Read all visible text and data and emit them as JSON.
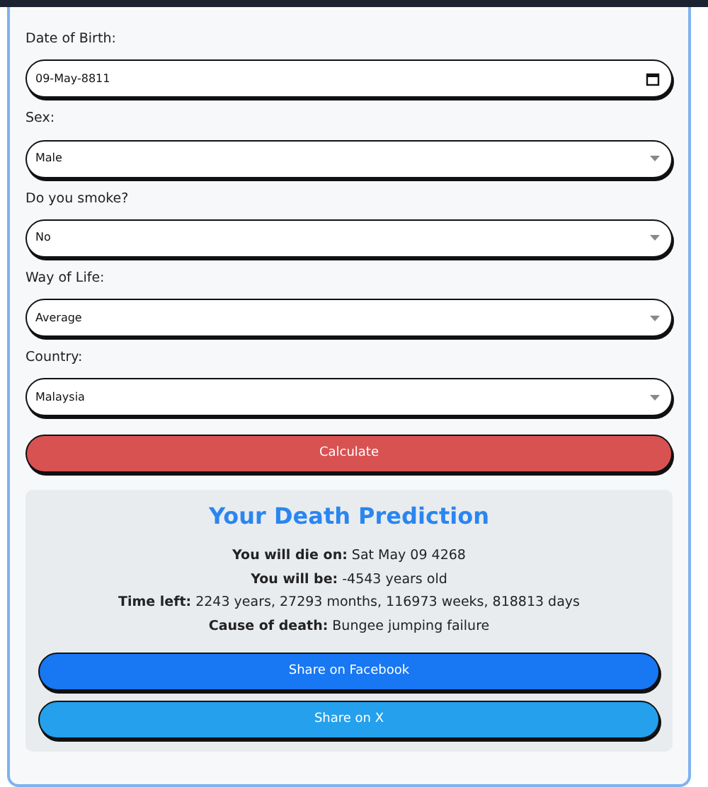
{
  "fields": [
    {
      "kind": "date",
      "label": "Date of Birth:",
      "value": "09-May-8811"
    },
    {
      "kind": "select",
      "label": "Sex:",
      "value": "Male"
    },
    {
      "kind": "select",
      "label": "Do you smoke?",
      "value": "No"
    },
    {
      "kind": "select",
      "label": "Way of Life:",
      "value": "Average"
    },
    {
      "kind": "select",
      "label": "Country:",
      "value": "Malaysia"
    }
  ],
  "calculate_button": "Calculate",
  "result": {
    "title": "Your Death Prediction",
    "lines": [
      "**You will die on:** Sat May 09 4268",
      "**You will be:** -4543 years old",
      "**Time left:** 2243 years, 27293 months, 116973 weeks, 818813 days",
      "**Cause of death:** Bungee jumping failure"
    ],
    "share_buttons": [
      {
        "kind": "facebook",
        "label": "Share on Facebook"
      },
      {
        "kind": "x",
        "label": "Share on X"
      }
    ]
  }
}
